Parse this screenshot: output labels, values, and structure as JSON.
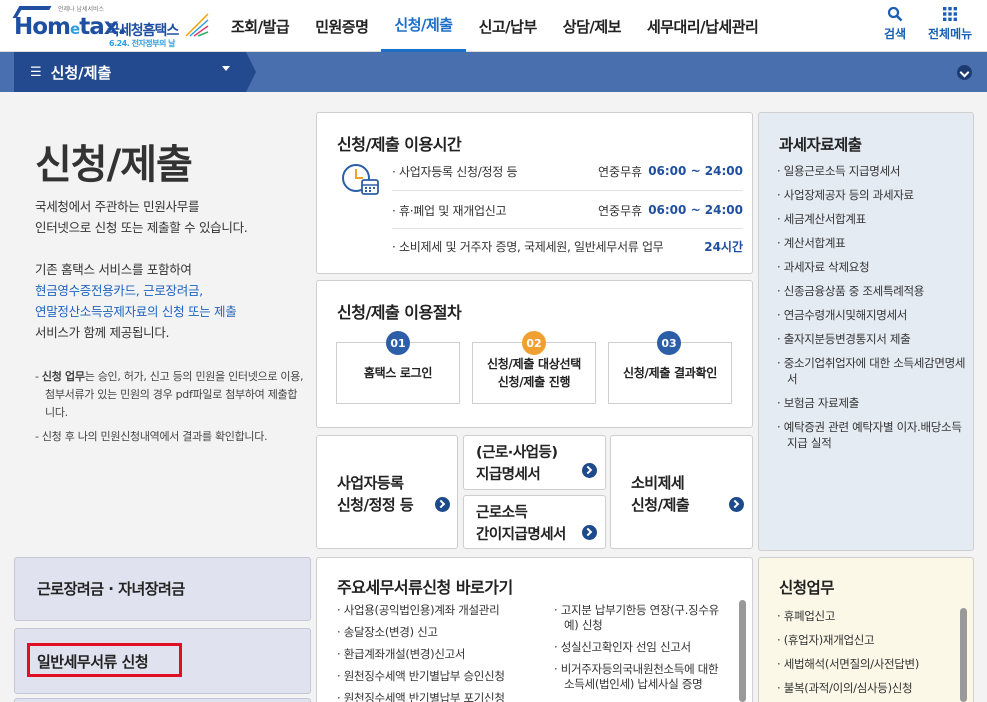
{
  "header": {
    "logo": {
      "text": "Hometax.",
      "small": "언제나 납세서비스",
      "name": "국세청홈택스",
      "sub": "6.24. 전자정부의 날"
    },
    "menu": [
      "조회/발급",
      "민원증명",
      "신청/제출",
      "신고/납부",
      "상담/제보",
      "세무대리/납세관리"
    ],
    "active_menu": "신청/제출",
    "search_label": "검색",
    "allmenu_label": "전체메뉴"
  },
  "subbar": {
    "title": "신청/제출"
  },
  "intro": {
    "title": "신청/제출",
    "p1": [
      "국세청에서 주관하는 민원사무를",
      "인터넷으로 신청 또는 제출할 수 있습니다."
    ],
    "p2_plain": "기존 홈택스 서비스를 포함하여",
    "p2_blue": [
      "현금영수증전용카드, 근로장려금,",
      "연말정산소득공제자료의 신청 또는 제출"
    ],
    "p2_tail": "서비스가 함께 제공됩니다.",
    "note1_bold": "신청 업무",
    "note1": "는 승인, 허가, 신고 등의 민원을 인터넷으로 이용, 첨부서류가 있는 민원의 경우 pdf파일로 첨부하여 제출합니다.",
    "note2": "- 신청 후 나의 민원신청내역에서 결과를 확인합니다."
  },
  "hours": {
    "title": "신청/제출 이용시간",
    "rows": [
      {
        "label": "· 사업자등록 신청/정정 등",
        "year": "연중무휴",
        "time": "06:00 ~ 24:00"
      },
      {
        "label": "· 휴·폐업 및 재개업신고",
        "year": "연중무휴",
        "time": "06:00 ~ 24:00"
      },
      {
        "label": "· 소비제세 및 거주자 증명, 국제세원, 일반세무서류 업무",
        "year": "",
        "time": "24시간"
      }
    ]
  },
  "procedure": {
    "title": "신청/제출 이용절차",
    "steps": [
      {
        "num": "01",
        "label": "홈택스 로그인",
        "color": "#2d5ea8"
      },
      {
        "num": "02",
        "label": "신청/제출 대상선택\n신청/제출 진행",
        "color": "#f0a030"
      },
      {
        "num": "03",
        "label": "신청/제출 결과확인",
        "color": "#2d5ea8"
      }
    ]
  },
  "quick": {
    "business": "사업자등록\n신청/정정 등",
    "payment": "(근로·사업등)\n지급명세서",
    "simple": "근로소득\n간이지급명세서",
    "consume": "소비제세\n신청/제출"
  },
  "tax_data": {
    "title": "과세자료제출",
    "items": [
      "· 일용근로소득 지급명세서",
      "· 사업장제공자 등의 과세자료",
      "· 세금계산서합계표",
      "· 계산서합계표",
      "· 과세자료 삭제요청",
      "· 신종금융상품 중 조세특례적용",
      "· 연금수령개시및해지명세서",
      "· 출자지분등변경통지서 제출",
      "· 중소기업취업자에 대한 소득세감면명세서",
      "· 보험금 자료제출",
      "· 예탁증권 관련 예탁자별 이자.배당소득 지급 실적"
    ]
  },
  "left_boxes": {
    "incentive": "근로장려금 · 자녀장려금",
    "general": "일반세무서류 신청"
  },
  "shortcuts": {
    "title": "주요세무서류신청 바로가기",
    "col1": [
      "· 사업용(공익법인용)계좌 개설관리",
      "· 송달장소(변경) 신고",
      "· 환급계좌개설(변경)신고서",
      "· 원천징수세액 반기별납부 승인신청",
      "· 원천징수세액 반기별납부 포기신청"
    ],
    "col2": [
      "· 고지분 납부기한등 연장(구.징수유예) 신청",
      "· 성실신고확인자 선임 신고서",
      "· 비거주자등의국내원천소득에 대한 소득세(법인세) 납세사실 증명"
    ]
  },
  "application": {
    "title": "신청업무",
    "items": [
      "· 휴폐업신고",
      "· (휴업자)재개업신고",
      "· 세법해석(서면질의/사전답변)",
      "· 불복(과적/이의/심사등)신청"
    ]
  }
}
